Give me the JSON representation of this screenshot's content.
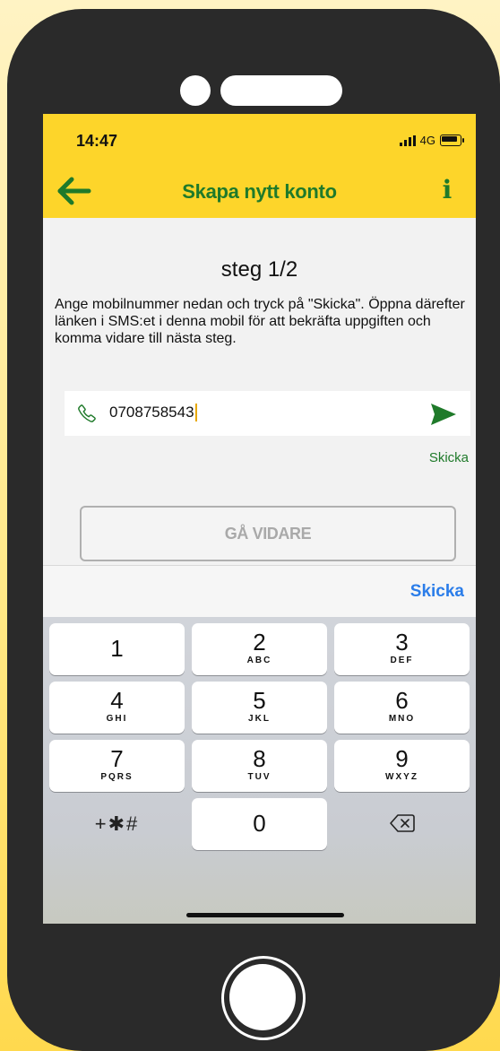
{
  "status_bar": {
    "time": "14:47",
    "network": "4G"
  },
  "nav": {
    "title": "Skapa nytt konto",
    "back_icon": "arrow-left-icon",
    "info_label": "i"
  },
  "step": {
    "title": "steg 1/2"
  },
  "instructions": "Ange mobilnummer nedan och tryck på \"Skicka\". Öppna därefter länken i SMS:et i denna mobil för att bekräfta uppgiften och komma vidare till nästa steg.",
  "phone_field": {
    "value": "0708758543",
    "icon": "phone-icon"
  },
  "send_label": "Skicka",
  "continue_button": "GÅ VIDARE",
  "keyboard": {
    "accessory_send": "Skicka",
    "keys": [
      {
        "num": "1",
        "letters": ""
      },
      {
        "num": "2",
        "letters": "ABC"
      },
      {
        "num": "3",
        "letters": "DEF"
      },
      {
        "num": "4",
        "letters": "GHI"
      },
      {
        "num": "5",
        "letters": "JKL"
      },
      {
        "num": "6",
        "letters": "MNO"
      },
      {
        "num": "7",
        "letters": "PQRS"
      },
      {
        "num": "8",
        "letters": "TUV"
      },
      {
        "num": "9",
        "letters": "WXYZ"
      },
      {
        "num": "0",
        "letters": ""
      }
    ],
    "symbols": "+✱#"
  },
  "colors": {
    "brand_yellow": "#fdd52a",
    "brand_green": "#1f7a2a",
    "ios_blue": "#2b7de9"
  }
}
